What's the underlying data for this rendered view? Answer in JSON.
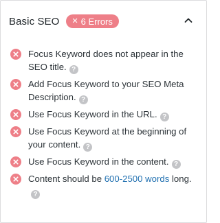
{
  "section": {
    "title": "Basic SEO",
    "badge": {
      "icon": "x-icon",
      "symbol": "✕",
      "label": "6 Errors",
      "color": "#ee7f88"
    },
    "collapse_icon": "chevron-up-icon"
  },
  "help_symbol": "?",
  "items": [
    {
      "icon": "error-icon",
      "text": "Focus Keyword does not appear in the SEO title."
    },
    {
      "icon": "error-icon",
      "text": "Add Focus Keyword to your SEO Meta Description."
    },
    {
      "icon": "error-icon",
      "text": "Use Focus Keyword in the URL."
    },
    {
      "icon": "error-icon",
      "text": "Use Focus Keyword at the beginning of your content."
    },
    {
      "icon": "error-icon",
      "text": "Use Focus Keyword in the content."
    },
    {
      "icon": "error-icon",
      "text_before": "Content should be",
      "link": "600-2500 words",
      "text_after": "long."
    }
  ],
  "colors": {
    "error": "#ee7f88",
    "link": "#2271b1",
    "help": "#c3c4c7"
  }
}
